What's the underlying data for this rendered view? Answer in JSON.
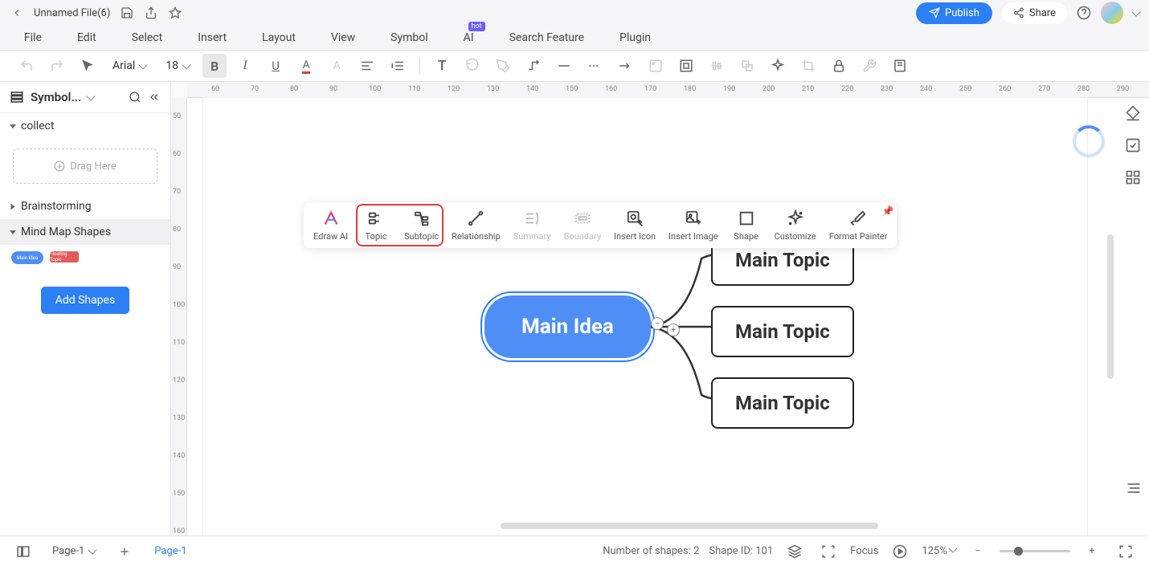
{
  "header": {
    "filename": "Unnamed File(6)",
    "publish_label": "Publish",
    "share_label": "Share"
  },
  "menu": [
    "File",
    "Edit",
    "Select",
    "Insert",
    "Layout",
    "View",
    "Symbol",
    "AI",
    "Search Feature",
    "Plugin"
  ],
  "ai_badge": "hot",
  "toolbar": {
    "font_family": "Arial",
    "font_size": "18"
  },
  "sidebar": {
    "title": "Symbol...",
    "sections": {
      "collect": "collect",
      "drag": "Drag Here",
      "brainstorming": "Brainstorming",
      "mindmap": "Mind Map Shapes",
      "add_btn": "Add Shapes"
    }
  },
  "ruler_h": [
    "60",
    "70",
    "80",
    "90",
    "100",
    "110",
    "120",
    "130",
    "140",
    "150",
    "160",
    "170",
    "180",
    "190",
    "200",
    "210",
    "220",
    "230",
    "240",
    "250",
    "260",
    "270",
    "280",
    "290"
  ],
  "ruler_v": [
    "50",
    "60",
    "70",
    "80",
    "90",
    "100",
    "110",
    "120",
    "130",
    "140",
    "150",
    "160"
  ],
  "float_tb": [
    {
      "label": "Edraw AI",
      "icon": "ai"
    },
    {
      "label": "Topic",
      "icon": "topic"
    },
    {
      "label": "Subtopic",
      "icon": "subtopic"
    },
    {
      "label": "Relationship",
      "icon": "rel"
    },
    {
      "label": "Summary",
      "icon": "sum",
      "disabled": true
    },
    {
      "label": "Boundary",
      "icon": "bound",
      "disabled": true
    },
    {
      "label": "Insert Icon",
      "icon": "iicon"
    },
    {
      "label": "Insert Image",
      "icon": "iimg"
    },
    {
      "label": "Shape",
      "icon": "shape"
    },
    {
      "label": "Customize",
      "icon": "cust"
    },
    {
      "label": "Format Painter",
      "icon": "fmt"
    }
  ],
  "nodes": {
    "main": "Main Idea",
    "topics": [
      "Main Topic",
      "Main Topic",
      "Main Topic"
    ]
  },
  "status": {
    "page_sel": "Page-1",
    "page_tab": "Page-1",
    "shapes_count": "Number of shapes: 2",
    "shape_id": "Shape ID: 101",
    "focus": "Focus",
    "zoom": "125%"
  }
}
